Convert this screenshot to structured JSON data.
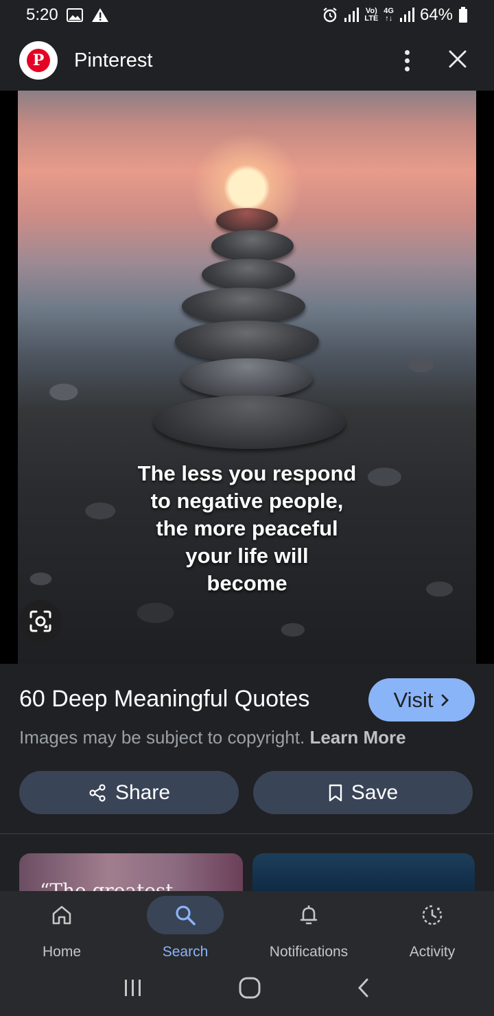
{
  "status_bar": {
    "time": "5:20",
    "network_top": "Vo)",
    "network_bottom": "LTE",
    "network2_top": "4G",
    "network2_bottom": "↑↓",
    "battery": "64%"
  },
  "app_bar": {
    "title": "Pinterest",
    "logo_letter": "P"
  },
  "image": {
    "quote_lines": [
      "The less you respond",
      "to negative people,",
      "the more peaceful",
      "your life will",
      "become"
    ]
  },
  "info": {
    "title": "60 Deep Meaningful Quotes",
    "visit_label": "Visit",
    "copyright_text": "Images may be subject to copyright.",
    "learn_more": "Learn More",
    "share_label": "Share",
    "save_label": "Save"
  },
  "related": {
    "thumb1_text": "“The greatest"
  },
  "bottom_nav": {
    "items": [
      {
        "label": "Home",
        "icon": "home-icon"
      },
      {
        "label": "Search",
        "icon": "search-icon"
      },
      {
        "label": "Notifications",
        "icon": "bell-icon"
      },
      {
        "label": "Activity",
        "icon": "activity-icon"
      }
    ],
    "active": "Search"
  },
  "colors": {
    "background": "#202124",
    "accent": "#8ab4f8",
    "button_bg": "#394457",
    "pinterest_red": "#e60023"
  }
}
